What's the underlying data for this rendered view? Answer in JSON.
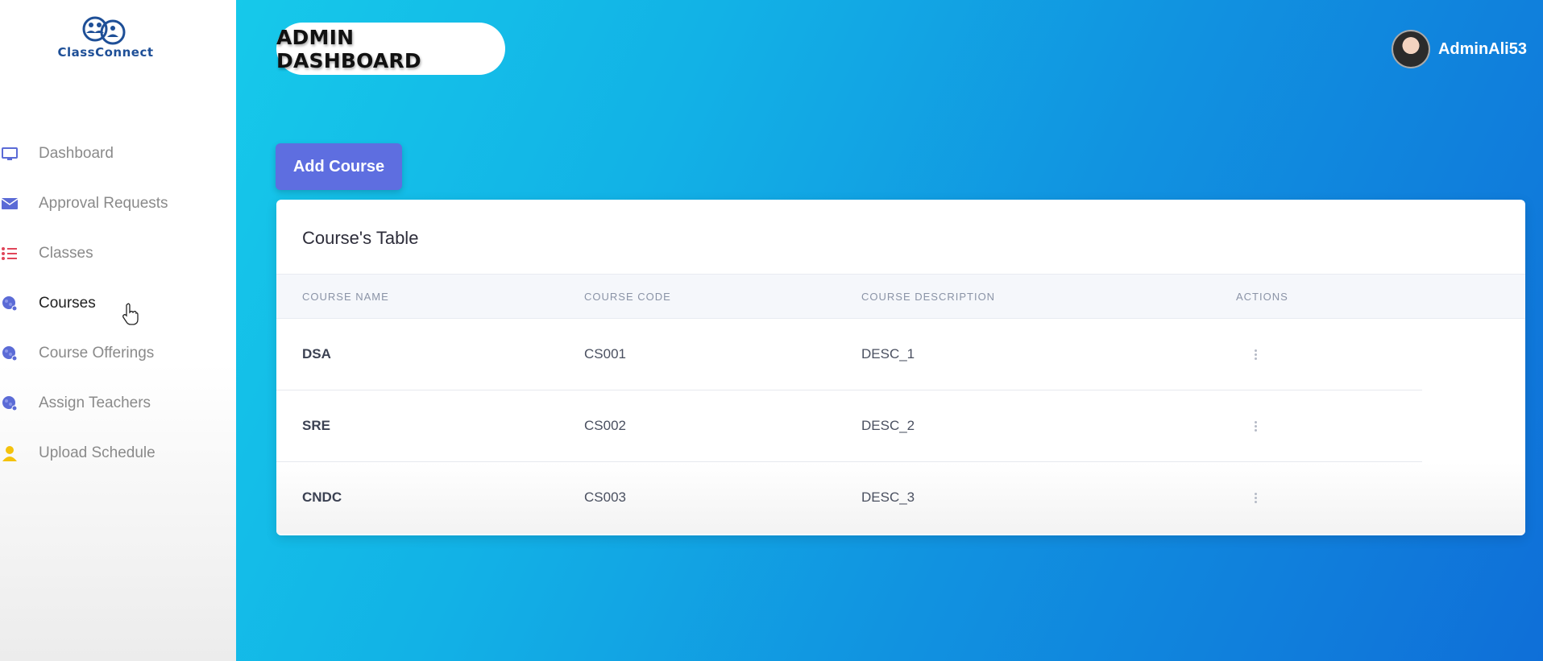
{
  "app": {
    "logo_text": "ClassConnect",
    "page_title": "ADMIN DASHBOARD",
    "user_name": "AdminAli53"
  },
  "sidebar": {
    "items": [
      {
        "label": "Dashboard",
        "icon": "monitor-icon",
        "active": false
      },
      {
        "label": "Approval Requests",
        "icon": "envelope-icon",
        "active": false
      },
      {
        "label": "Classes",
        "icon": "list-icon",
        "active": false
      },
      {
        "label": "Courses",
        "icon": "globe-icon",
        "active": true
      },
      {
        "label": "Course Offerings",
        "icon": "globe-icon",
        "active": false
      },
      {
        "label": "Assign Teachers",
        "icon": "globe-icon",
        "active": false
      },
      {
        "label": "Upload Schedule",
        "icon": "user-icon",
        "active": false
      }
    ]
  },
  "main": {
    "add_button": "Add Course",
    "table": {
      "title": "Course's Table",
      "columns": [
        "COURSE NAME",
        "COURSE CODE",
        "COURSE DESCRIPTION",
        "ACTIONS"
      ],
      "rows": [
        {
          "name": "DSA",
          "code": "CS001",
          "description": "DESC_1"
        },
        {
          "name": "SRE",
          "code": "CS002",
          "description": "DESC_2"
        },
        {
          "name": "CNDC",
          "code": "CS003",
          "description": "DESC_3"
        }
      ]
    }
  },
  "colors": {
    "accent": "#5e6ee0",
    "gradient_start": "#16c9ea",
    "gradient_end": "#0f6fd8",
    "logo": "#1e4f97"
  }
}
